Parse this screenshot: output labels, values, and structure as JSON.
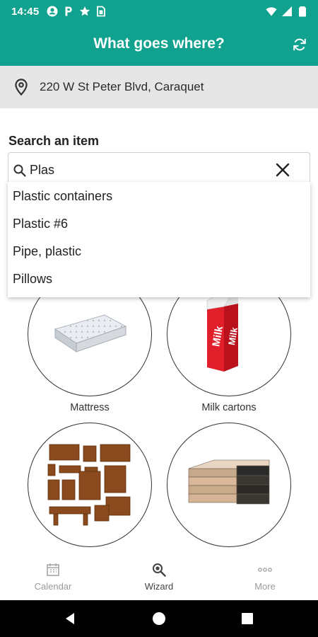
{
  "status_bar": {
    "time": "14:45",
    "left_icons": [
      "account-circle-icon",
      "parking-icon",
      "star-icon",
      "sim-icon"
    ],
    "right_icons": [
      "wifi-icon",
      "signal-icon",
      "battery-icon"
    ]
  },
  "app_bar": {
    "title": "What goes where?",
    "refresh_icon": "refresh-icon"
  },
  "address": {
    "text": "220 W St Peter Blvd, Caraquet",
    "icon": "location-pin-icon"
  },
  "search": {
    "label": "Search an item",
    "value": "Plas",
    "icon": "search-icon",
    "clear_icon": "close-icon"
  },
  "suggestions": [
    "Plastic containers",
    "Plastic #6",
    "Pipe, plastic",
    "Pillows"
  ],
  "items": [
    {
      "label": "Mattress",
      "image": "mattress-image"
    },
    {
      "label": "Milk cartons",
      "image": "milk-carton-image"
    },
    {
      "label": "",
      "image": "furniture-image"
    },
    {
      "label": "",
      "image": "books-image"
    }
  ],
  "bottom_nav": [
    {
      "label": "Calendar",
      "icon": "calendar-icon",
      "active": false
    },
    {
      "label": "Wizard",
      "icon": "wizard-search-icon",
      "active": true
    },
    {
      "label": "More",
      "icon": "more-icon",
      "active": false
    }
  ],
  "system_nav": [
    "back-icon",
    "home-icon",
    "recents-icon"
  ],
  "colors": {
    "primary": "#10a28f",
    "address_bg": "#e6e6e6"
  }
}
